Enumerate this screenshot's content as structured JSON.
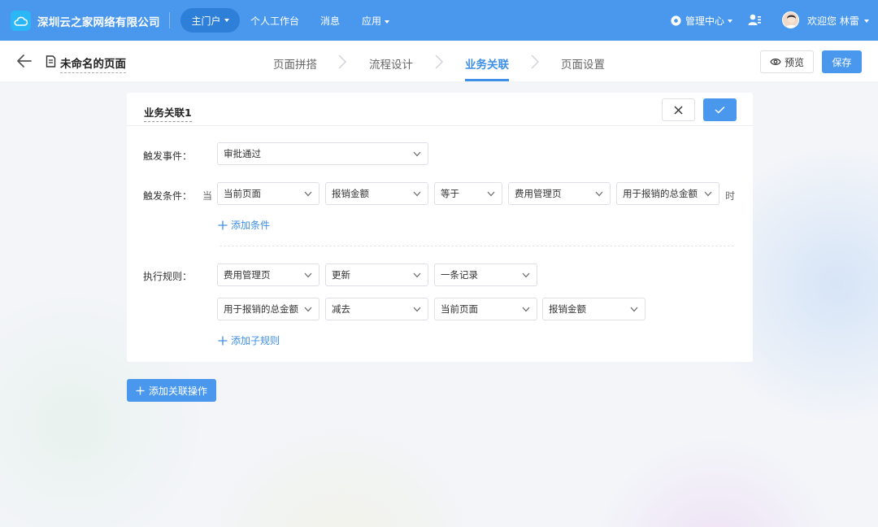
{
  "topbar": {
    "company": "深圳云之家网络有限公司",
    "nav_active": "主门户",
    "nav_items": [
      "个人工作台",
      "消息",
      "应用"
    ],
    "admin_center": "管理中心",
    "welcome": "欢迎您 林雷"
  },
  "subheader": {
    "page_name": "未命名的页面",
    "steps": [
      "页面拼搭",
      "流程设计",
      "业务关联",
      "页面设置"
    ],
    "active_step": "业务关联",
    "preview_label": "预览",
    "save_label": "保存"
  },
  "card": {
    "title": "业务关联1",
    "trigger_event": {
      "label": "触发事件：",
      "value": "审批通过"
    },
    "trigger_condition": {
      "label": "触发条件：",
      "prefix": "当",
      "suffix": "时",
      "selects": [
        "当前页面",
        "报销金额",
        "等于",
        "费用管理页",
        "用于报销的总金额"
      ],
      "add_label": "添加条件"
    },
    "execution_rule": {
      "label": "执行规则：",
      "row1": [
        "费用管理页",
        "更新",
        "一条记录"
      ],
      "row2": [
        "用于报销的总金额",
        "减去",
        "当前页面",
        "报销金额"
      ],
      "add_label": "添加子规则"
    }
  },
  "add_operation_label": "添加关联操作",
  "colors": {
    "primary": "#4a98ee",
    "topbar": "#4a98ee",
    "pill": "#2e7fd8",
    "active_step": "#3d8fe8"
  }
}
